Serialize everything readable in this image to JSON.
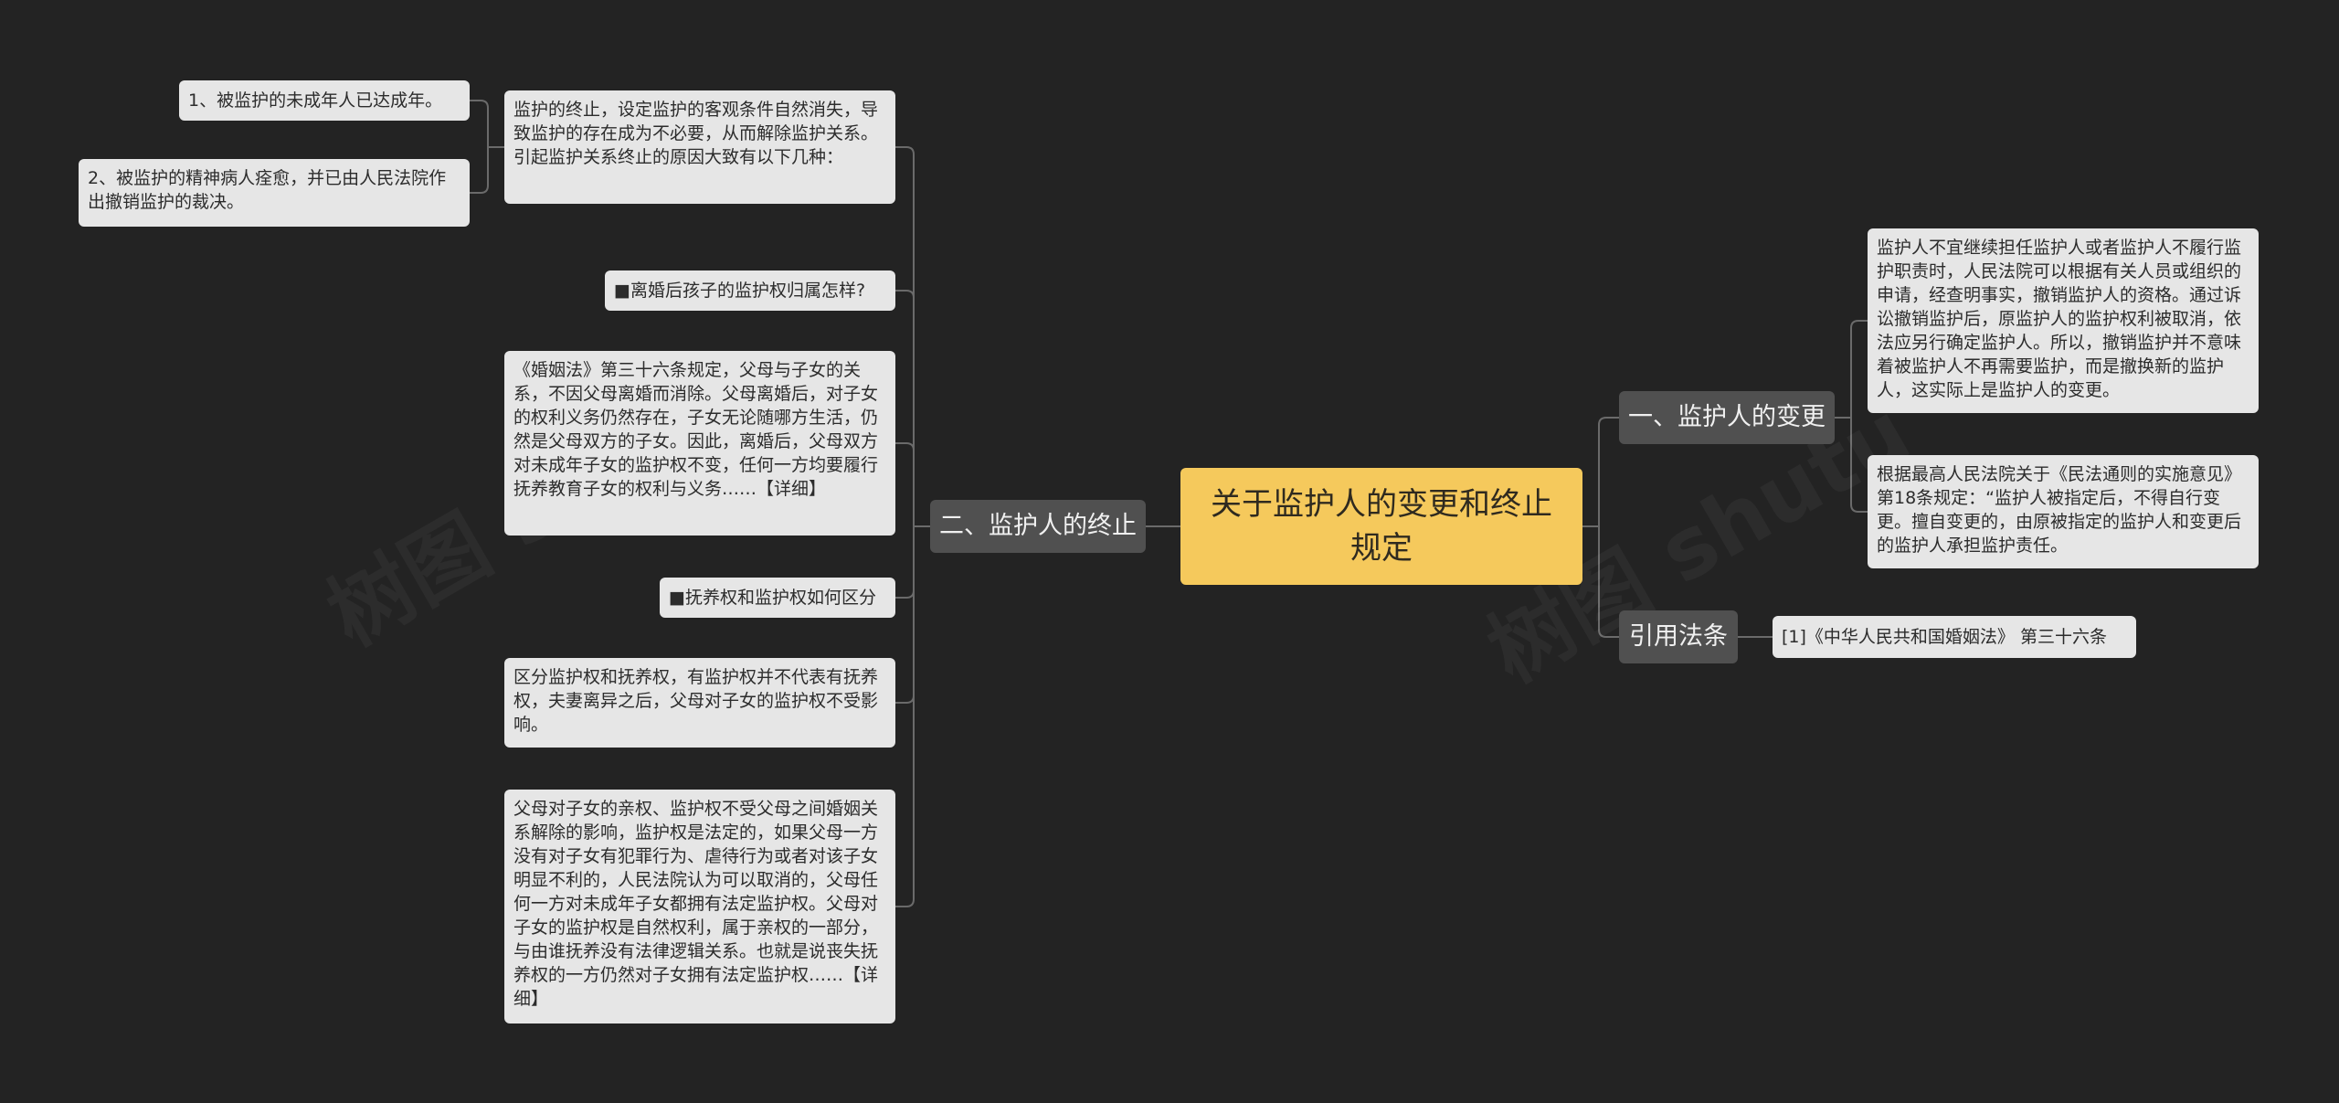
{
  "mindmap": {
    "root": {
      "label": "关于监护人的变更和终止规定"
    },
    "right_branches": [
      {
        "label": "一、监护人的变更",
        "children": [
          "监护人不宜继续担任监护人或者监护人不履行监护职责时，人民法院可以根据有关人员或组织的申请，经查明事实，撤销监护人的资格。通过诉讼撤销监护后，原监护人的监护权利被取消，依法应另行确定监护人。所以，撤销监护并不意味着被监护人不再需要监护，而是撤换新的监护人，这实际上是监护人的变更。",
          "根据最高人民法院关于《民法通则的实施意见》第18条规定：“监护人被指定后，不得自行变更。擅自变更的，由原被指定的监护人和变更后的监护人承担监护责任。"
        ]
      },
      {
        "label": "引用法条",
        "children": [
          "[1]《中华人民共和国婚姻法》 第三十六条"
        ]
      }
    ],
    "left_branch": {
      "label": "二、监护人的终止",
      "children": [
        "监护的终止，设定监护的客观条件自然消失，导致监护的存在成为不必要，从而解除监护关系。引起监护关系终止的原因大致有以下几种：",
        "■离婚后孩子的监护权归属怎样?",
        "《婚姻法》第三十六条规定，父母与子女的关系，不因父母离婚而消除。父母离婚后，对子女的权利义务仍然存在，子女无论随哪方生活，仍然是父母双方的子女。因此，离婚后，父母双方对未成年子女的监护权不变，任何一方均要履行抚养教育子女的权利与义务……【详细】",
        "■抚养权和监护权如何区分",
        "区分监护权和抚养权，有监护权并不代表有抚养权，夫妻离异之后，父母对子女的监护权不受影响。",
        "父母对子女的亲权、监护权不受父母之间婚姻关系解除的影响，监护权是法定的，如果父母一方没有对子女有犯罪行为、虐待行为或者对该子女明显不利的，人民法院认为可以取消的，父母任何一方对未成年子女都拥有法定监护权。父母对子女的监护权是自然权利，属于亲权的一部分，与由谁抚养没有法律逻辑关系。也就是说丧失抚养权的一方仍然对子女拥有法定监护权……【详细】"
      ],
      "sub_children": [
        "1、被监护的未成年人已达成年。",
        "2、被监护的精神病人痊愈，并已由人民法院作出撤销监护的裁决。"
      ]
    }
  },
  "colors": {
    "background": "#232323",
    "root_fill": "#f5c95c",
    "branch_fill": "#505050",
    "leaf_fill": "#e6e6e6",
    "connector": "#6a6a6a"
  }
}
